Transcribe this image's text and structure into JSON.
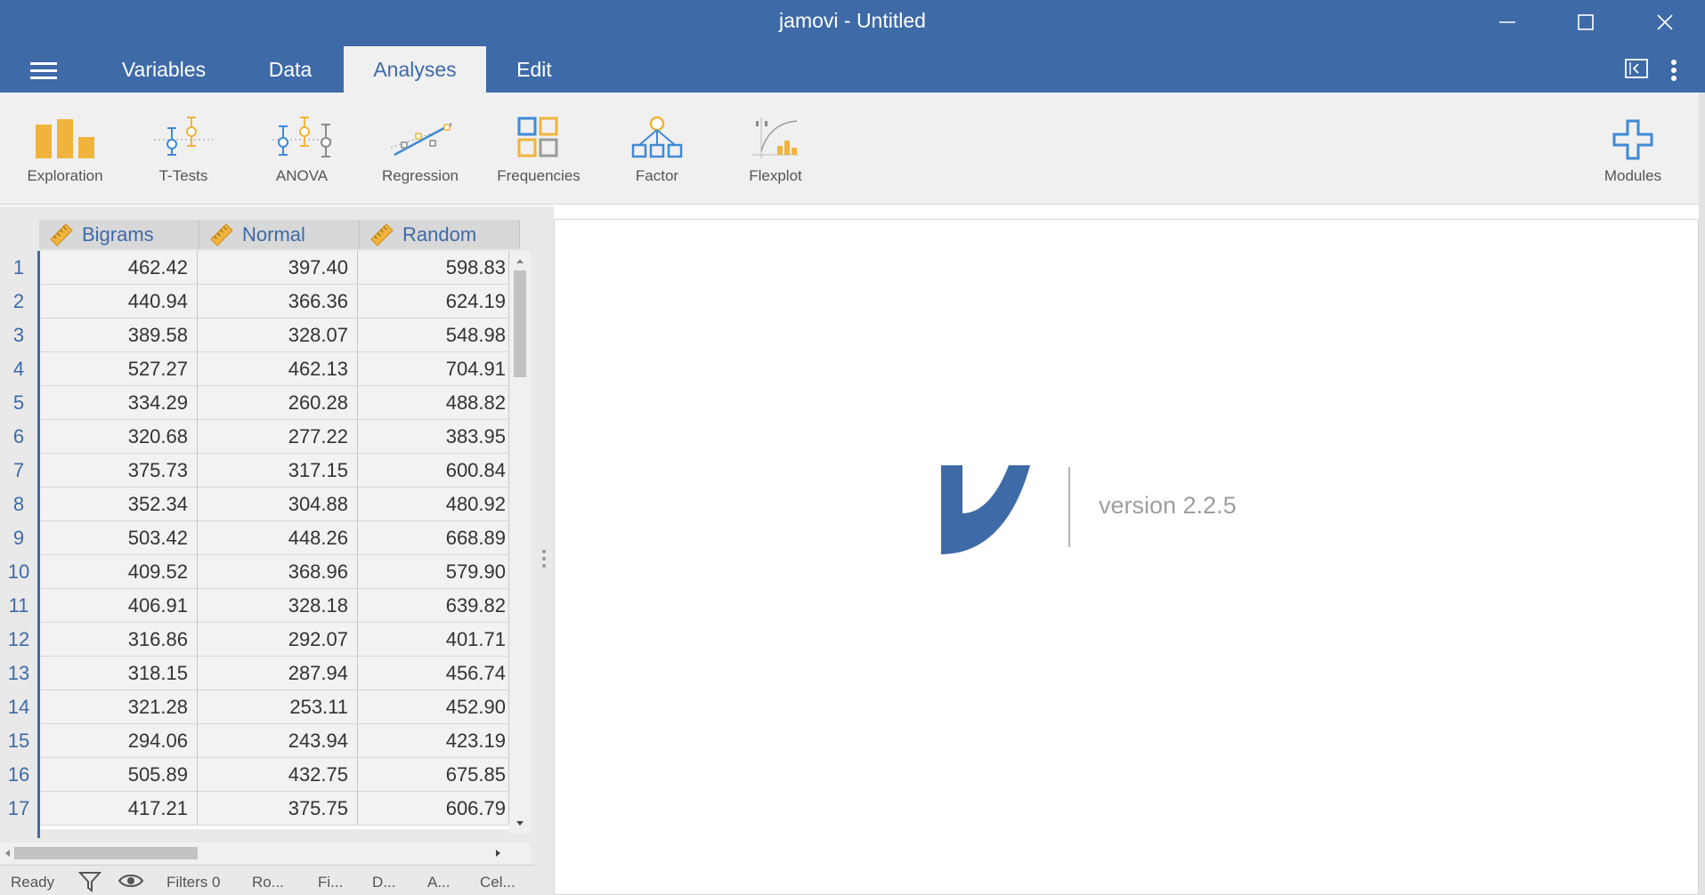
{
  "window": {
    "title": "jamovi - Untitled"
  },
  "menu": {
    "tabs": [
      {
        "label": "Variables"
      },
      {
        "label": "Data"
      },
      {
        "label": "Analyses"
      },
      {
        "label": "Edit"
      }
    ],
    "active_tab": "Analyses"
  },
  "ribbon": {
    "items": [
      {
        "label": "Exploration",
        "icon": "bar-chart-icon"
      },
      {
        "label": "T-Tests",
        "icon": "t-tests-icon"
      },
      {
        "label": "ANOVA",
        "icon": "anova-icon"
      },
      {
        "label": "Regression",
        "icon": "regression-icon"
      },
      {
        "label": "Frequencies",
        "icon": "frequencies-icon"
      },
      {
        "label": "Factor",
        "icon": "factor-icon"
      },
      {
        "label": "Flexplot",
        "icon": "flexplot-icon"
      }
    ],
    "modules": {
      "label": "Modules",
      "icon": "plus-icon"
    }
  },
  "spreadsheet": {
    "columns": [
      "Bigrams",
      "Normal",
      "Random"
    ],
    "rows": [
      {
        "n": "1",
        "v": [
          "462.42",
          "397.40",
          "598.83"
        ]
      },
      {
        "n": "2",
        "v": [
          "440.94",
          "366.36",
          "624.19"
        ]
      },
      {
        "n": "3",
        "v": [
          "389.58",
          "328.07",
          "548.98"
        ]
      },
      {
        "n": "4",
        "v": [
          "527.27",
          "462.13",
          "704.91"
        ]
      },
      {
        "n": "5",
        "v": [
          "334.29",
          "260.28",
          "488.82"
        ]
      },
      {
        "n": "6",
        "v": [
          "320.68",
          "277.22",
          "383.95"
        ]
      },
      {
        "n": "7",
        "v": [
          "375.73",
          "317.15",
          "600.84"
        ]
      },
      {
        "n": "8",
        "v": [
          "352.34",
          "304.88",
          "480.92"
        ]
      },
      {
        "n": "9",
        "v": [
          "503.42",
          "448.26",
          "668.89"
        ]
      },
      {
        "n": "10",
        "v": [
          "409.52",
          "368.96",
          "579.90"
        ]
      },
      {
        "n": "11",
        "v": [
          "406.91",
          "328.18",
          "639.82"
        ]
      },
      {
        "n": "12",
        "v": [
          "316.86",
          "292.07",
          "401.71"
        ]
      },
      {
        "n": "13",
        "v": [
          "318.15",
          "287.94",
          "456.74"
        ]
      },
      {
        "n": "14",
        "v": [
          "321.28",
          "253.11",
          "452.90"
        ]
      },
      {
        "n": "15",
        "v": [
          "294.06",
          "243.94",
          "423.19"
        ]
      },
      {
        "n": "16",
        "v": [
          "505.89",
          "432.75",
          "675.85"
        ]
      },
      {
        "n": "17",
        "v": [
          "417.21",
          "375.75",
          "606.79"
        ]
      }
    ]
  },
  "results": {
    "version": "version 2.2.5"
  },
  "status": {
    "ready": "Ready",
    "filters": "Filters 0",
    "rows": "Ro...",
    "filtered": "Fi...",
    "deleted": "D...",
    "added": "A...",
    "cells": "Cel..."
  },
  "colors": {
    "brand": "#3e6aa8",
    "accent": "#f0b43c"
  }
}
